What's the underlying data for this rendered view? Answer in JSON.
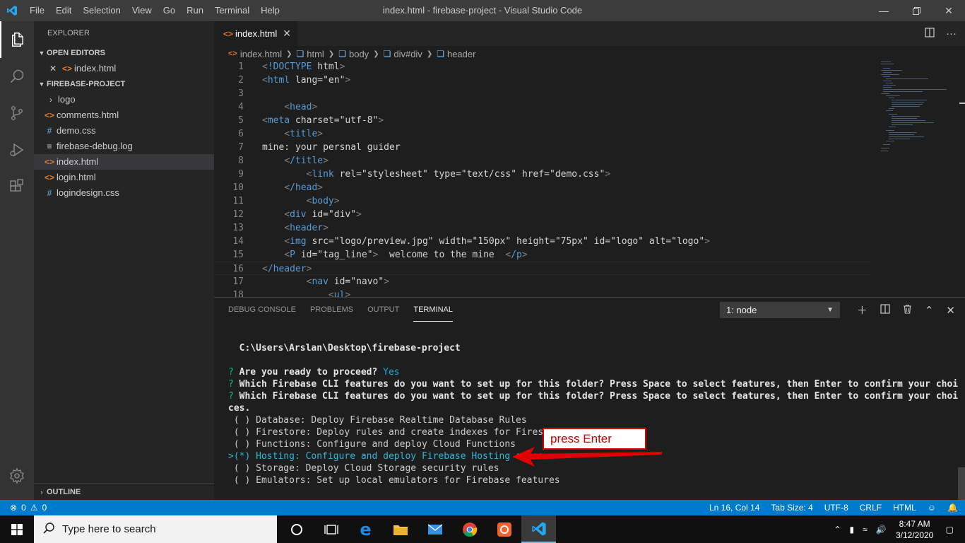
{
  "window": {
    "title": "index.html - firebase-project - Visual Studio Code",
    "menu": [
      "File",
      "Edit",
      "Selection",
      "View",
      "Go",
      "Run",
      "Terminal",
      "Help"
    ]
  },
  "sidebar": {
    "header": "EXPLORER",
    "open_editors": {
      "label": "OPEN EDITORS",
      "items": [
        {
          "name": "index.html",
          "icon": "html-icon"
        }
      ]
    },
    "project": {
      "label": "FIREBASE-PROJECT",
      "items": [
        {
          "name": "logo",
          "icon": "folder-icon"
        },
        {
          "name": "comments.html",
          "icon": "html-icon"
        },
        {
          "name": "demo.css",
          "icon": "css-icon"
        },
        {
          "name": "firebase-debug.log",
          "icon": "log-icon"
        },
        {
          "name": "index.html",
          "icon": "html-icon",
          "selected": true
        },
        {
          "name": "login.html",
          "icon": "html-icon"
        },
        {
          "name": "logindesign.css",
          "icon": "css-icon"
        }
      ]
    },
    "outline_label": "OUTLINE"
  },
  "editor": {
    "tab_label": "index.html",
    "breadcrumb": [
      "index.html",
      "html",
      "body",
      "div#div",
      "header"
    ],
    "lines": [
      {
        "n": "1",
        "text": "<!DOCTYPE html>"
      },
      {
        "n": "2",
        "text": "<html lang=\"en\">"
      },
      {
        "n": "3",
        "text": ""
      },
      {
        "n": "4",
        "text": "    <head>"
      },
      {
        "n": "5",
        "text": "<meta charset=\"utf-8\">"
      },
      {
        "n": "6",
        "text": "    <title>"
      },
      {
        "n": "7",
        "text": "mine: your persnal guider"
      },
      {
        "n": "8",
        "text": "    </title>"
      },
      {
        "n": "9",
        "text": "        <link rel=\"stylesheet\" type=\"text/css\" href=\"demo.css\">"
      },
      {
        "n": "10",
        "text": "    </head>"
      },
      {
        "n": "11",
        "text": "        <body>"
      },
      {
        "n": "12",
        "text": "    <div id=\"div\">"
      },
      {
        "n": "13",
        "text": "    <header>"
      },
      {
        "n": "14",
        "text": "    <img src=\"logo/preview.jpg\" width=\"150px\" height=\"75px\" id=\"logo\" alt=\"logo\">"
      },
      {
        "n": "15",
        "text": "    <P id=\"tag_line\">  welcome to the mine  </p>"
      },
      {
        "n": "16",
        "text": "</header>"
      },
      {
        "n": "17",
        "text": "        <nav id=\"navo\">"
      },
      {
        "n": "18",
        "text": "            <ul>"
      }
    ]
  },
  "panel": {
    "tabs": [
      "DEBUG CONSOLE",
      "PROBLEMS",
      "OUTPUT",
      "TERMINAL"
    ],
    "active_tab": "TERMINAL",
    "terminal_select": "1: node",
    "terminal": {
      "path": "C:\\Users\\Arslan\\Desktop\\firebase-project",
      "q1_prompt": "?",
      "q1_text": "Are you ready to proceed?",
      "q1_answer": "Yes",
      "q2_prompt": "?",
      "q2_text": "Which Firebase CLI features do you want to set up for this folder? Press Space to select features, then Enter to confirm your choi",
      "q3_prompt": "?",
      "q3_text": "Which Firebase CLI features do you want to set up for this folder? Press Space to select features, then Enter to confirm your choi",
      "q3_cont": "ces.",
      "options": [
        {
          "prefix": " ( ) ",
          "text": "Database: Deploy Firebase Realtime Database Rules",
          "highlighted": false
        },
        {
          "prefix": " ( ) ",
          "text": "Firestore: Deploy rules and create indexes for Firestore",
          "highlighted": false
        },
        {
          "prefix": " ( ) ",
          "text": "Functions: Configure and deploy Cloud Functions",
          "highlighted": false
        },
        {
          "prefix": ">(*) ",
          "text": "Hosting: Configure and deploy Firebase Hosting sites",
          "highlighted": true
        },
        {
          "prefix": " ( ) ",
          "text": "Storage: Deploy Cloud Storage security rules",
          "highlighted": false
        },
        {
          "prefix": " ( ) ",
          "text": "Emulators: Set up local emulators for Firebase features",
          "highlighted": false
        }
      ]
    }
  },
  "annotation": {
    "text": "press Enter",
    "color": "#e00000"
  },
  "statusbar": {
    "errors": "0",
    "warnings": "0",
    "position": "Ln 16, Col 14",
    "tab_size": "Tab Size: 4",
    "encoding": "UTF-8",
    "eol": "CRLF",
    "language": "HTML"
  },
  "taskbar": {
    "search_placeholder": "Type here to search",
    "time": "8:47 AM",
    "date": "3/12/2020",
    "apps": [
      "task-view-icon",
      "edge-icon",
      "file-explorer-icon",
      "mail-icon",
      "chrome-icon",
      "app-icon",
      "vscode-icon"
    ]
  },
  "colors": {
    "accent": "#007acc",
    "terminal_highlight": "#29b8db"
  }
}
